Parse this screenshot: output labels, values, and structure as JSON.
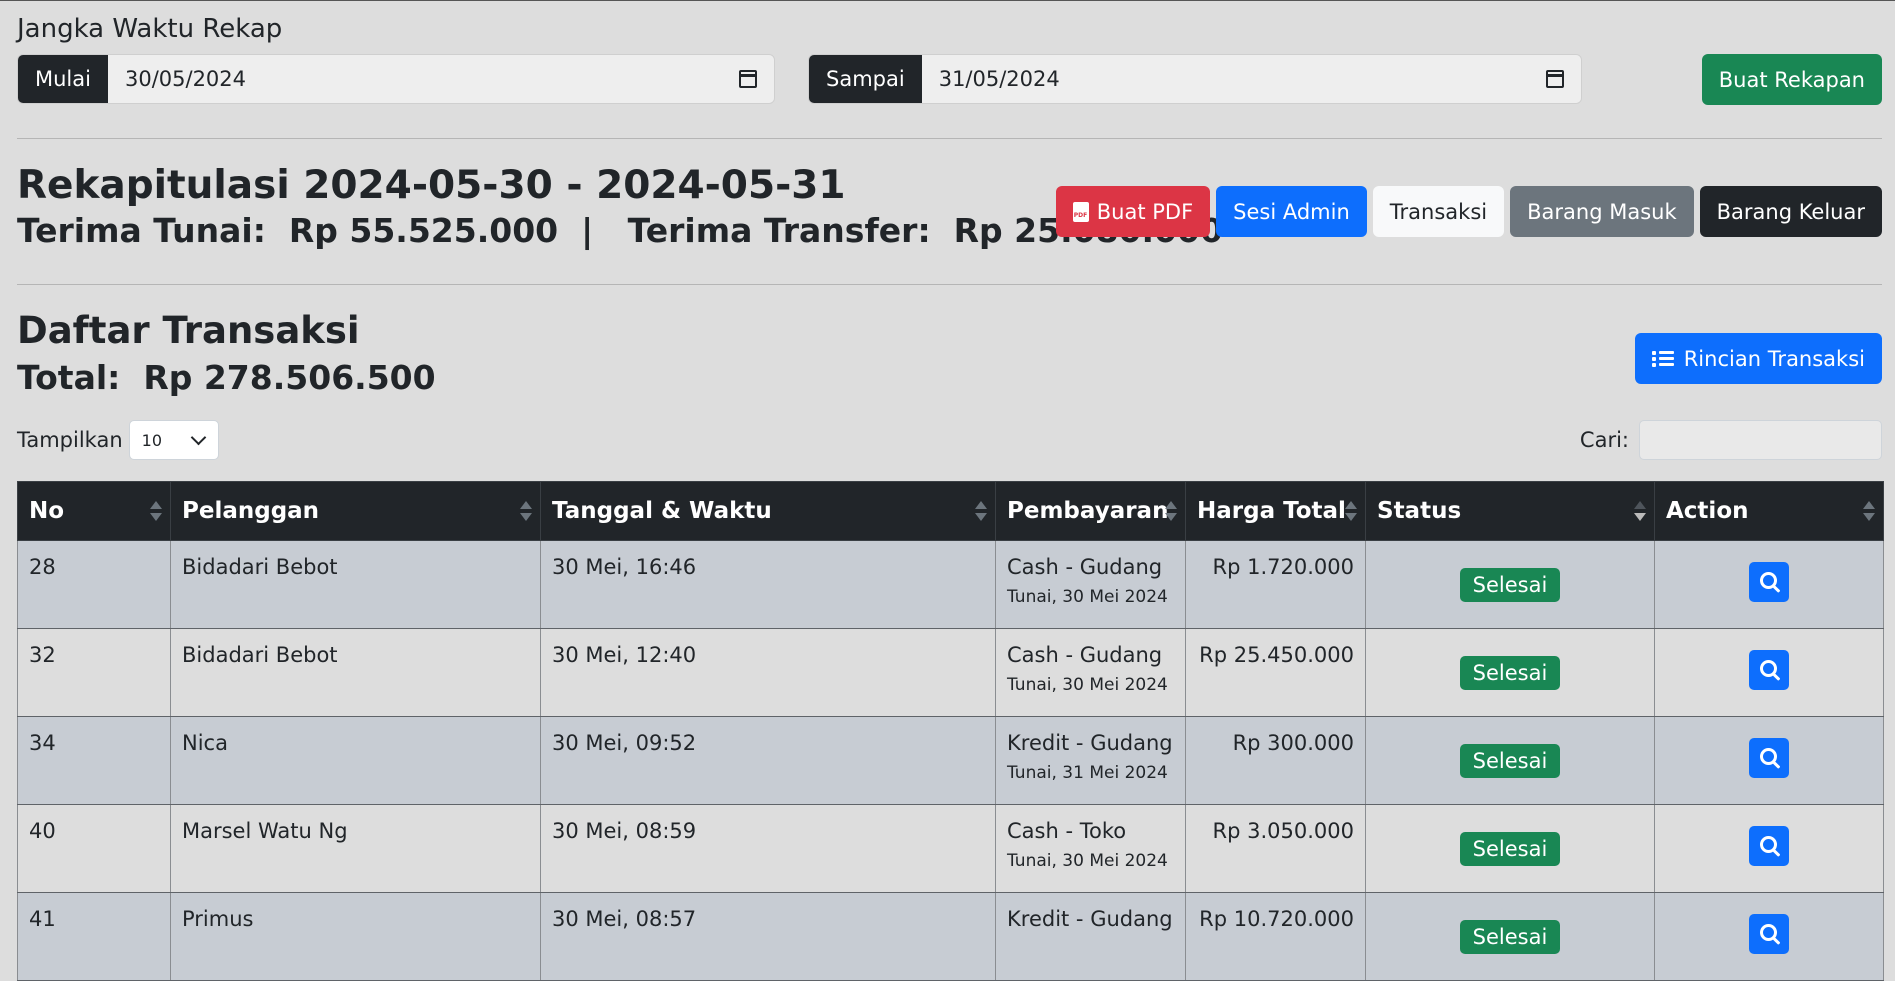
{
  "range": {
    "title": "Jangka Waktu Rekap",
    "start_label": "Mulai",
    "start_value": "30/05/2024",
    "end_label": "Sampai",
    "end_value": "31/05/2024",
    "button": "Buat Rekapan"
  },
  "rekap": {
    "title": "Rekapitulasi 2024-05-30 - 2024-05-31",
    "subtitle": "Terima Tunai:  Rp 55.525.000  |   Terima Transfer:  Rp 25.080.000"
  },
  "actions": {
    "pdf": "Buat PDF",
    "sesi": "Sesi Admin",
    "transaksi": "Transaksi",
    "masuk": "Barang Masuk",
    "keluar": "Barang Keluar"
  },
  "daftar": {
    "title": "Daftar Transaksi",
    "total": "Total:  Rp 278.506.500",
    "rincian": "Rincian Transaksi"
  },
  "controls": {
    "tampilkan_label": "Tampilkan",
    "page_size": "10",
    "cari_label": "Cari:"
  },
  "table": {
    "headers": [
      "No",
      "Pelanggan",
      "Tanggal & Waktu",
      "Pembayaran",
      "Harga Total",
      "Status",
      "Action"
    ],
    "rows": [
      {
        "no": "28",
        "pelanggan": "Bidadari Bebot",
        "waktu": "30 Mei, 16:46",
        "bayar": "Cash - Gudang",
        "bayar_sub": "Tunai, 30 Mei 2024",
        "harga": "Rp 1.720.000",
        "status": "Selesai"
      },
      {
        "no": "32",
        "pelanggan": "Bidadari Bebot",
        "waktu": "30 Mei, 12:40",
        "bayar": "Cash - Gudang",
        "bayar_sub": "Tunai, 30 Mei 2024",
        "harga": "Rp 25.450.000",
        "status": "Selesai"
      },
      {
        "no": "34",
        "pelanggan": "Nica",
        "waktu": "30 Mei, 09:52",
        "bayar": "Kredit - Gudang",
        "bayar_sub": "Tunai, 31 Mei 2024",
        "harga": "Rp 300.000",
        "status": "Selesai"
      },
      {
        "no": "40",
        "pelanggan": "Marsel Watu Ng",
        "waktu": "30 Mei, 08:59",
        "bayar": "Cash - Toko",
        "bayar_sub": "Tunai, 30 Mei 2024",
        "harga": "Rp 3.050.000",
        "status": "Selesai"
      },
      {
        "no": "41",
        "pelanggan": "Primus",
        "waktu": "30 Mei, 08:57",
        "bayar": "Kredit - Gudang",
        "bayar_sub": "",
        "harga": "Rp 10.720.000",
        "status": "Selesai"
      }
    ]
  },
  "colors": {
    "success": "#198754",
    "primary": "#0d6efd",
    "danger": "#dc3545",
    "secondary": "#6c757d",
    "dark": "#212529"
  }
}
